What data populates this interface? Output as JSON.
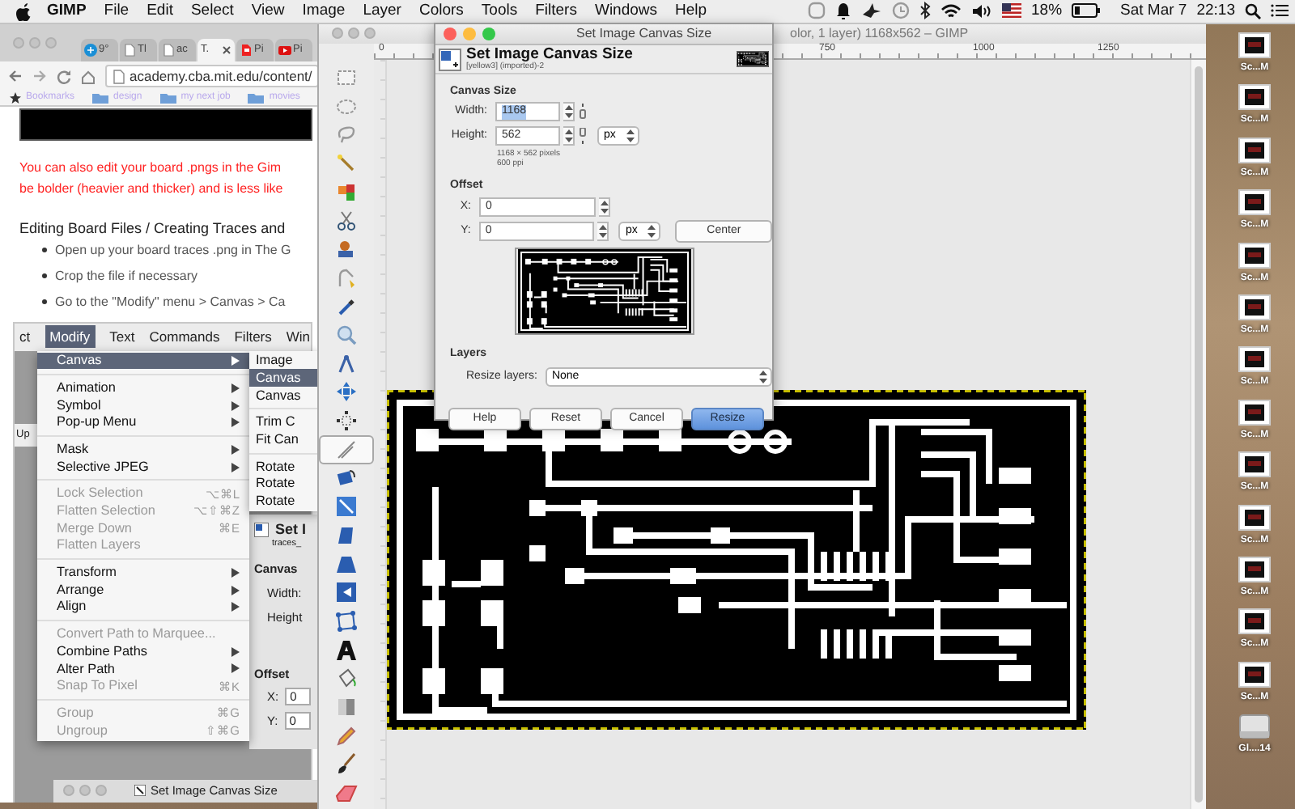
{
  "menu_bar": {
    "app_name": "GIMP",
    "items": [
      "File",
      "Edit",
      "Select",
      "View",
      "Image",
      "Layer",
      "Colors",
      "Tools",
      "Filters",
      "Windows",
      "Help"
    ],
    "battery": "18%",
    "date": "Sat Mar 7",
    "time": "22:13"
  },
  "desktop_icons": [
    {
      "label": "Sc...M"
    },
    {
      "label": "Sc...M"
    },
    {
      "label": "Sc...M"
    },
    {
      "label": "Sc...M"
    },
    {
      "label": "Sc...M"
    },
    {
      "label": "Sc...M"
    },
    {
      "label": "Sc...M"
    },
    {
      "label": "Sc...M"
    },
    {
      "label": "Sc...M"
    },
    {
      "label": "Sc...M"
    },
    {
      "label": "Sc...M"
    },
    {
      "label": "Sc...M"
    },
    {
      "label": "Sc...M"
    },
    {
      "label": "Gl....14"
    }
  ],
  "browser": {
    "tabs": [
      {
        "label": "9°",
        "selected": false
      },
      {
        "label": "Tl",
        "selected": false
      },
      {
        "label": "ac",
        "selected": false
      },
      {
        "label": "T.",
        "selected": true
      },
      {
        "label": "Pi",
        "selected": false
      },
      {
        "label": "Pi",
        "selected": false
      }
    ],
    "url": "academy.cba.mit.edu/content/",
    "bookmarks": [
      "Bookmarks",
      "design",
      "my next job",
      "movies"
    ],
    "note_lines": [
      "You can also edit your board .pngs in the Gim",
      "be bolder (heavier and thicker) and is less like"
    ],
    "heading": "Editing Board Files / Creating Traces and",
    "bullets": [
      "Open up your board traces .png in The G",
      "Crop the file if necessary",
      "Go to the \"Modify\" menu > Canvas > Ca"
    ],
    "screenshot": {
      "menu_bar": [
        {
          "label": "ct",
          "selected": false
        },
        {
          "label": "Modify",
          "selected": true
        },
        {
          "label": "Text",
          "selected": false
        },
        {
          "label": "Commands",
          "selected": false
        },
        {
          "label": "Filters",
          "selected": false
        },
        {
          "label": "Win",
          "selected": false
        }
      ],
      "side_label": "Up",
      "menu": [
        [
          {
            "label": "Canvas",
            "submenu": true,
            "disabled": false,
            "selected": true
          }
        ],
        [
          {
            "label": "Animation",
            "submenu": true,
            "disabled": false,
            "selected": false
          },
          {
            "label": "Symbol",
            "submenu": true,
            "disabled": false,
            "selected": false
          },
          {
            "label": "Pop-up Menu",
            "submenu": true,
            "disabled": false,
            "selected": false
          }
        ],
        [
          {
            "label": "Mask",
            "submenu": true,
            "disabled": false,
            "selected": false
          },
          {
            "label": "Selective JPEG",
            "submenu": true,
            "disabled": false,
            "selected": false
          }
        ],
        [
          {
            "label": "Lock Selection",
            "submenu": false,
            "disabled": true,
            "selected": false,
            "shortcut": "⌥⌘L"
          },
          {
            "label": "Flatten Selection",
            "submenu": false,
            "disabled": true,
            "selected": false,
            "shortcut": "⌥⇧⌘Z"
          },
          {
            "label": "Merge Down",
            "submenu": false,
            "disabled": true,
            "selected": false,
            "shortcut": "⌘E"
          },
          {
            "label": "Flatten Layers",
            "submenu": false,
            "disabled": true,
            "selected": false
          }
        ],
        [
          {
            "label": "Transform",
            "submenu": true,
            "disabled": false,
            "selected": false
          },
          {
            "label": "Arrange",
            "submenu": true,
            "disabled": false,
            "selected": false
          },
          {
            "label": "Align",
            "submenu": true,
            "disabled": false,
            "selected": false
          }
        ],
        [
          {
            "label": "Convert Path to Marquee...",
            "submenu": false,
            "disabled": true,
            "selected": false
          },
          {
            "label": "Combine Paths",
            "submenu": true,
            "disabled": false,
            "selected": false
          },
          {
            "label": "Alter Path",
            "submenu": true,
            "disabled": false,
            "selected": false
          },
          {
            "label": "Snap To Pixel",
            "submenu": false,
            "disabled": true,
            "selected": false,
            "shortcut": "⌘K"
          }
        ],
        [
          {
            "label": "Group",
            "submenu": false,
            "disabled": true,
            "selected": false,
            "shortcut": "⌘G"
          },
          {
            "label": "Ungroup",
            "submenu": false,
            "disabled": true,
            "selected": false,
            "shortcut": "⇧⌘G"
          }
        ]
      ],
      "submenu": [
        [
          {
            "label": "Image",
            "selected": false
          },
          {
            "label": "Canvas",
            "selected": true
          },
          {
            "label": "Canvas",
            "selected": false
          }
        ],
        [
          {
            "label": "Trim C",
            "selected": false
          },
          {
            "label": "Fit Can",
            "selected": false
          }
        ],
        [
          {
            "label": "Rotate",
            "selected": false
          },
          {
            "label": "Rotate",
            "selected": false
          },
          {
            "label": "Rotate",
            "selected": false
          }
        ]
      ],
      "panel": {
        "title": "Set I",
        "subtitle": "traces_",
        "section": "Canvas",
        "fields": [
          "Width:",
          "Height"
        ],
        "offset": "Offset",
        "offset_fields": [
          {
            "label": "X:",
            "value": "0"
          },
          {
            "label": "Y:",
            "value": "0"
          }
        ]
      },
      "window_title": "Set Image Canvas Size"
    }
  },
  "gimp": {
    "title": "olor, 1 layer) 1168x562 – GIMP",
    "ruler_labels": [
      "0",
      "750",
      "1000",
      "1250"
    ],
    "tools": [
      {
        "selected": false
      },
      {
        "selected": false
      },
      {
        "selected": false
      },
      {
        "selected": false
      },
      {
        "selected": false
      },
      {
        "selected": false
      },
      {
        "selected": false
      },
      {
        "selected": false
      },
      {
        "selected": false
      },
      {
        "selected": false
      },
      {
        "selected": false
      },
      {
        "selected": false
      },
      {
        "selected": false
      },
      {
        "selected": true
      },
      {
        "selected": false
      },
      {
        "selected": false
      },
      {
        "selected": false
      },
      {
        "selected": false
      },
      {
        "selected": false
      },
      {
        "selected": false
      },
      {
        "selected": false
      },
      {
        "selected": false
      },
      {
        "selected": false
      },
      {
        "selected": false
      },
      {
        "selected": false
      },
      {
        "selected": false
      }
    ]
  },
  "dialog": {
    "title": "Set Image Canvas Size",
    "heading": "Set Image Canvas Size",
    "subtitle": "[yellow3] (imported)-2",
    "canvas_size": {
      "label": "Canvas Size",
      "width": {
        "label": "Width:",
        "value": "1168",
        "text_selected": true
      },
      "height": {
        "label": "Height:",
        "value": "562",
        "text_selected": false
      },
      "unit": "px",
      "info": [
        "1168 × 562 pixels",
        "600 ppi"
      ]
    },
    "offset": {
      "label": "Offset",
      "x": {
        "label": "X:",
        "value": "0"
      },
      "y": {
        "label": "Y:",
        "value": "0"
      },
      "unit": "px",
      "center_button": "Center"
    },
    "layers": {
      "label": "Layers",
      "resize_label": "Resize layers:",
      "resize_value": "None"
    },
    "buttons": [
      {
        "label": "Help",
        "default": false
      },
      {
        "label": "Reset",
        "default": false
      },
      {
        "label": "Cancel",
        "default": false
      },
      {
        "label": "Resize",
        "default": true
      }
    ]
  }
}
